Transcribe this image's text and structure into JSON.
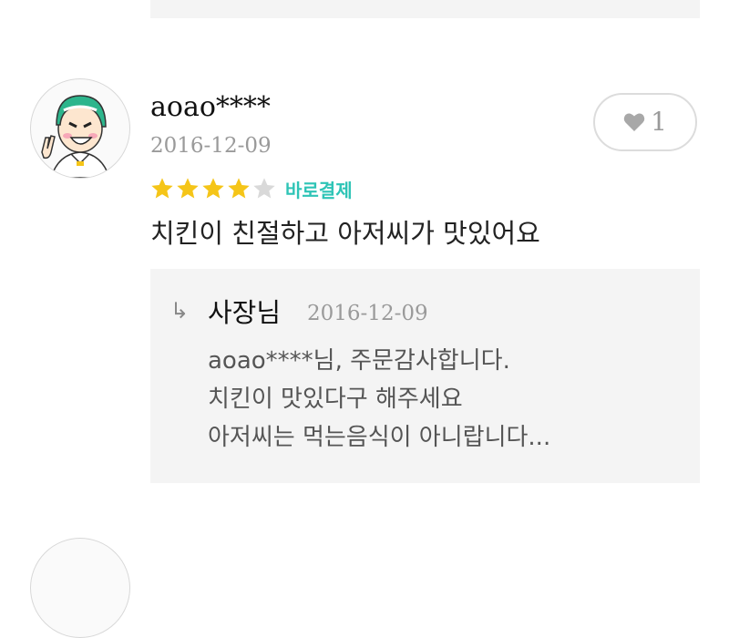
{
  "review": {
    "username": "aoao****",
    "date": "2016-12-09",
    "like_count": "1",
    "rating": 4,
    "rating_max": 5,
    "payment_badge": "바로결제",
    "text": "치킨이 친절하고 아저씨가 맛있어요"
  },
  "reply": {
    "arrow": "↳",
    "author": "사장님",
    "date": "2016-12-09",
    "lines": [
      "aoao****님, 주문감사합니다.",
      "치킨이 맛있다구 해주세요",
      "아저씨는 먹는음식이 아니랍니다..."
    ]
  },
  "colors": {
    "star_filled": "#f5c518",
    "star_empty": "#d9d9d9",
    "badge": "#2ec4b6",
    "panel_bg": "#f4f4f4",
    "helmet": "#2db58c"
  },
  "icons": {
    "like": "heart-icon",
    "avatar": "user-avatar-illustration"
  }
}
